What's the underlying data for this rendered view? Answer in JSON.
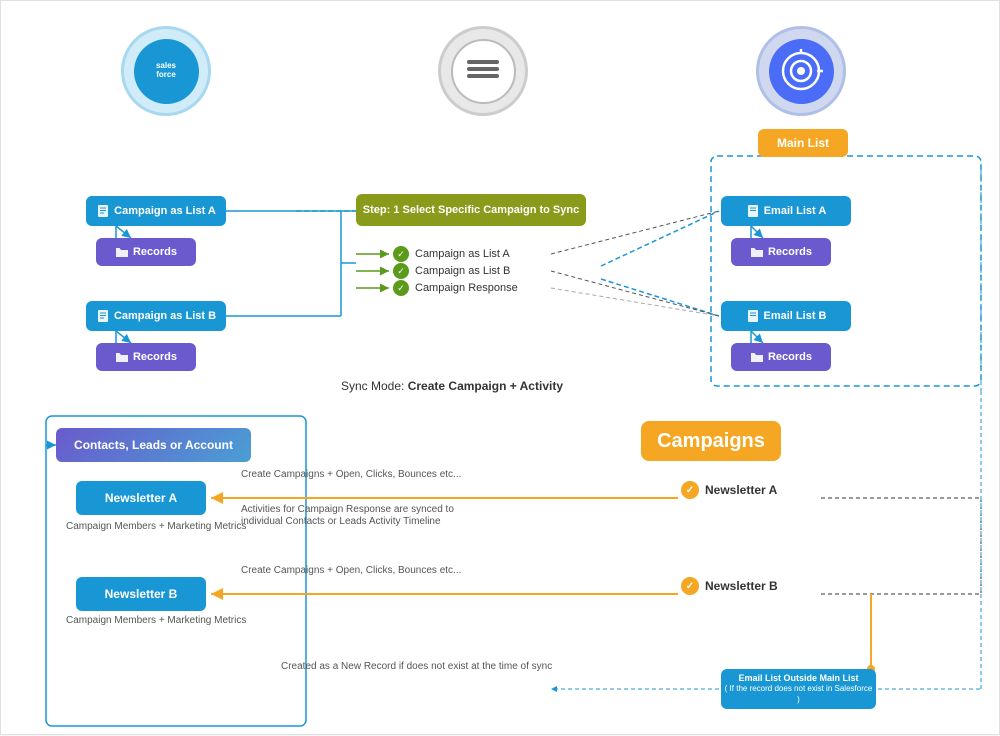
{
  "logos": {
    "salesforce": "salesforce",
    "syncapps": "SyncApps",
    "campaignmonitor": "campaign-monitor"
  },
  "labels": {
    "main_list": "Main List",
    "campaigns": "Campaigns",
    "step1": "Step: 1 Select Specific Campaign to Sync",
    "campaign_list_a": "Campaign as List A",
    "campaign_list_b": "Campaign as List B",
    "records_a": "Records",
    "records_b": "Records",
    "email_list_a": "Email List A",
    "email_list_b": "Email List B",
    "records_ea": "Records",
    "records_eb": "Records",
    "check1": "Campaign as List A",
    "check2": "Campaign as List B",
    "check3": "Campaign Response",
    "sync_mode": "Sync Mode:",
    "sync_mode_value": "Create Campaign + Activity",
    "contacts": "Contacts, Leads or Account",
    "newsletter_a": "Newsletter A",
    "newsletter_b": "Newsletter B",
    "newsletter_a_right": "Newsletter A",
    "newsletter_b_right": "Newsletter B",
    "members_a": "Campaign Members + Marketing Metrics",
    "members_b": "Campaign Members + Marketing Metrics",
    "create_campaigns": "Create Campaigns + Open, Clicks, Bounces etc...",
    "activities": "Activities for Campaign Response are synced to",
    "activities2": "individual Contacts or Leads Activity Timeline",
    "create_campaigns2": "Create Campaigns + Open, Clicks, Bounces etc...",
    "new_record": "Created as a New Record if does not exist at the time of sync",
    "outside_list_line1": "Email List Outside Main List",
    "outside_list_line2": "( If the record does not exist in Salesforce )"
  }
}
